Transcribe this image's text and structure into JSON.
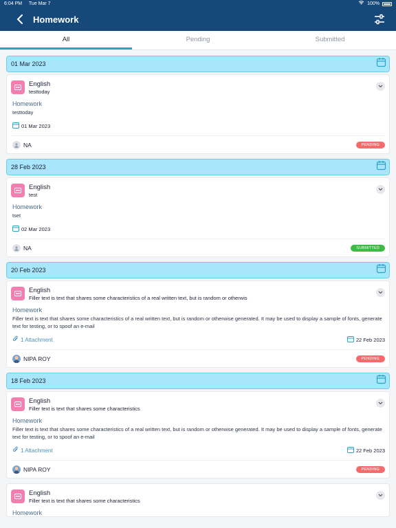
{
  "status_bar": {
    "time": "6:04 PM",
    "date": "Tue Mar 7",
    "battery": "100%"
  },
  "header": {
    "title": "Homework"
  },
  "tabs": [
    {
      "label": "All",
      "active": true
    },
    {
      "label": "Pending",
      "active": false
    },
    {
      "label": "Submitted",
      "active": false
    }
  ],
  "groups": [
    {
      "date": "01 Mar 2023",
      "card": {
        "subject": "English",
        "topic": "testtoday",
        "hw_label": "Homework",
        "hw_desc": "testtoday",
        "due": "01 Mar 2023",
        "attachment": "",
        "teacher": "NA",
        "status": "PENDING"
      }
    },
    {
      "date": "28 Feb 2023",
      "card": {
        "subject": "English",
        "topic": "test",
        "hw_label": "Homework",
        "hw_desc": "tset",
        "due": "02 Mar 2023",
        "attachment": "",
        "teacher": "NA",
        "status": "SUBMITTED"
      }
    },
    {
      "date": "20 Feb 2023",
      "card": {
        "subject": "English",
        "topic": "Filler text is text that shares some characteristics of a real written text, but is random or otherwis",
        "hw_label": "Homework",
        "hw_desc": "Filler text is text that shares some characteristics of a real written text, but is random or otherwise generated. It may be used to display a sample of fonts, generate text for testing, or to spoof an e-mail",
        "due": "22 Feb 2023",
        "attachment": "1 Attachment",
        "teacher": "NIPA ROY",
        "status": "PENDING"
      }
    },
    {
      "date": "18 Feb 2023",
      "card": {
        "subject": "English",
        "topic": "Filler text is text that shares some characteristics",
        "hw_label": "Homework",
        "hw_desc": "Filler text is text that shares some characteristics of a real written text, but is random or otherwise generated. It may be used to display a sample of fonts, generate text for testing, or to spoof an e-mail",
        "due": "22 Feb 2023",
        "attachment": "1 Attachment",
        "teacher": "NIPA ROY",
        "status": "PENDING"
      }
    },
    {
      "date": "",
      "card": {
        "subject": "English",
        "topic": "Filler text is text that shares some characteristics",
        "hw_label": "Homework",
        "hw_desc": "",
        "due": "",
        "attachment": "",
        "teacher": "",
        "status": ""
      }
    }
  ],
  "colors": {
    "header": "#16487a",
    "accent": "#2aa3c4",
    "date_bar": "#a8e6fb",
    "pending": "#f46b6b",
    "submitted": "#3fba45",
    "subject_icon": "#f37fb1"
  },
  "icons": [
    "back-arrow-icon",
    "filter-sliders-icon",
    "calendar-icon",
    "chevron-down-icon",
    "paperclip-icon",
    "person-icon",
    "book-icon",
    "wifi-icon",
    "battery-icon"
  ]
}
